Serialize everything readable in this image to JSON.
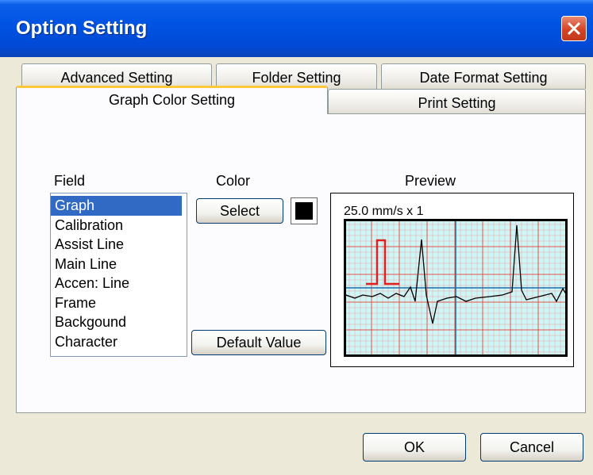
{
  "window": {
    "title": "Option Setting"
  },
  "tabs": {
    "advanced": "Advanced Setting",
    "folder": "Folder Setting",
    "date_format": "Date Format Setting",
    "graph_color": "Graph Color Setting",
    "print": "Print Setting"
  },
  "field": {
    "label": "Field",
    "items": [
      "Graph",
      "Calibration",
      "Assist Line",
      "Main Line",
      "Accen: Line",
      "Frame",
      "Backgound",
      "Character"
    ],
    "selected": "Graph"
  },
  "color": {
    "label": "Color",
    "select_button": "Select",
    "current_color": "#000000",
    "default_button": "Default Value"
  },
  "preview": {
    "label": "Preview",
    "speed_text": "25.0  mm/s x 1",
    "background_color": "#cdf7f7",
    "assist_line_color": "#f4a0a0",
    "main_line_color": "#e8504a",
    "accent_line_color": "#1f6fa8",
    "calibration_color": "#e02020",
    "graph_color": "#000000"
  },
  "buttons": {
    "ok": "OK",
    "cancel": "Cancel"
  }
}
